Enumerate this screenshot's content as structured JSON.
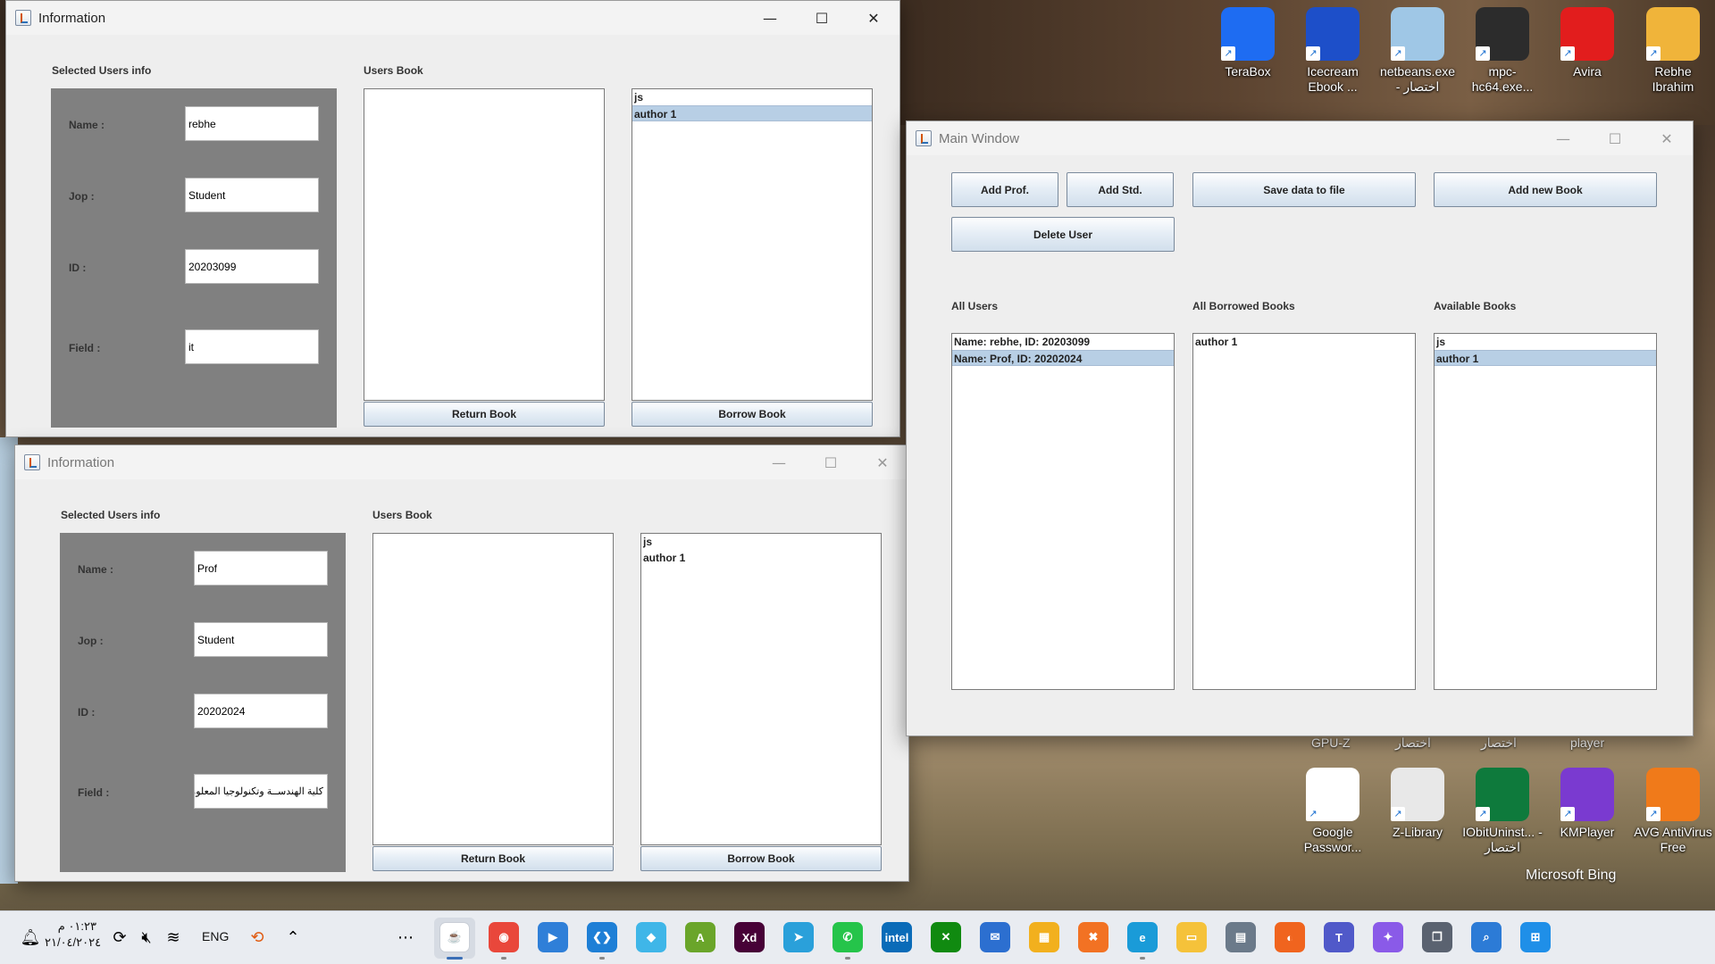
{
  "desktop": {
    "icons": [
      {
        "label": "TeraBox",
        "icon": "terabox-icon",
        "color": "#1e6cf2"
      },
      {
        "label": "Icecream Ebook ...",
        "icon": "icecream-ebook-icon",
        "color": "#1d4fc9"
      },
      {
        "label": "netbeans.exe - اختصار",
        "icon": "netbeans-icon",
        "color": "#9fc7e6"
      },
      {
        "label": "mpc-hc64.exe...",
        "icon": "mpc-hc-icon",
        "color": "#2c2c2c"
      },
      {
        "label": "Avira",
        "icon": "avira-icon",
        "color": "#e21d1d"
      },
      {
        "label": "Rebhe Ibrahim",
        "icon": "user-folder-icon",
        "color": "#f0b43a"
      },
      {
        "label": "Google Passwor...",
        "icon": "google-password-icon",
        "color": "#ffffff"
      },
      {
        "label": "Z-Library",
        "icon": "zlibrary-icon",
        "color": "#e8e8e8"
      },
      {
        "label": "IObitUninst... - اختصار",
        "icon": "iobit-uninstaller-icon",
        "color": "#0e7a3c"
      },
      {
        "label": "KMPlayer",
        "icon": "kmplayer-icon",
        "color": "#7a3ad0"
      },
      {
        "label": "AVG AntiVirus Free",
        "icon": "avg-icon",
        "color": "#f07a1a"
      }
    ],
    "partial_labels": [
      "GPU-Z",
      "اختصار",
      "اختصار",
      "player"
    ],
    "bing_text": "Microsoft Bing"
  },
  "window1": {
    "title": "Information",
    "selected_users_info_label": "Selected Users info",
    "users_book_label": "Users Book",
    "fields": [
      {
        "label": "Name :",
        "value": "rebhe"
      },
      {
        "label": "Jop :",
        "value": "Student"
      },
      {
        "label": "ID :",
        "value": "20203099"
      },
      {
        "label": "Field :",
        "value": "it"
      }
    ],
    "users_book_items": [],
    "available_items": [
      {
        "text": "js",
        "selected": false
      },
      {
        "text": "author 1",
        "selected": true
      }
    ],
    "return_button": "Return Book",
    "borrow_button": "Borrow Book"
  },
  "window2": {
    "title": "Information",
    "selected_users_info_label": "Selected Users info",
    "users_book_label": "Users Book",
    "fields": [
      {
        "label": "Name :",
        "value": "Prof"
      },
      {
        "label": "Jop :",
        "value": "Student"
      },
      {
        "label": "ID :",
        "value": "20202024"
      },
      {
        "label": "Field :",
        "value": "كلية الهندســة وتكنولوجيا المعلومات"
      }
    ],
    "users_book_items": [],
    "available_items": [
      {
        "text": "js",
        "selected": false
      },
      {
        "text": "author 1",
        "selected": false
      }
    ],
    "return_button": "Return Book",
    "borrow_button": "Borrow Book"
  },
  "main_window": {
    "title": "Main Window",
    "buttons": {
      "add_prof": "Add Prof.",
      "add_std": "Add Std.",
      "save_data": "Save data to file",
      "add_new_book": "Add new Book",
      "delete_user": "Delete User"
    },
    "all_users_label": "All Users",
    "all_borrowed_label": "All Borrowed Books",
    "available_books_label": "Available Books",
    "all_users": [
      {
        "text": "Name: rebhe, ID: 20203099",
        "selected": false
      },
      {
        "text": "Name: Prof, ID: 20202024",
        "selected": true
      }
    ],
    "borrowed_books": [
      {
        "text": "author 1",
        "selected": false
      }
    ],
    "available_books": [
      {
        "text": "js",
        "selected": false
      },
      {
        "text": "author 1",
        "selected": true
      }
    ]
  },
  "taskbar": {
    "time": "٠١:٢٣ م",
    "date": "٢١/٠٤/٢٠٢٤",
    "language": "ENG",
    "apps": [
      {
        "name": "java-app-icon",
        "color": "#ffffff",
        "glyph": "☕"
      },
      {
        "name": "chrome-icon",
        "color": "#e9473b",
        "glyph": "◉"
      },
      {
        "name": "media-player-icon",
        "color": "#2f7fd8",
        "glyph": "▶"
      },
      {
        "name": "vscode-icon",
        "color": "#1e7fd6",
        "glyph": "❮❯"
      },
      {
        "name": "store-app-icon",
        "color": "#3fb6e8",
        "glyph": "◆"
      },
      {
        "name": "dictionary-app-icon",
        "color": "#6aa52a",
        "glyph": "A"
      },
      {
        "name": "adobe-xd-icon",
        "color": "#470137",
        "glyph": "Xd"
      },
      {
        "name": "telegram-icon",
        "color": "#2aa0da",
        "glyph": "➤"
      },
      {
        "name": "whatsapp-icon",
        "color": "#25c44a",
        "glyph": "✆"
      },
      {
        "name": "intel-icon",
        "color": "#0a6bb8",
        "glyph": "intel"
      },
      {
        "name": "xbox-icon",
        "color": "#108a10",
        "glyph": "✕"
      },
      {
        "name": "mail-icon",
        "color": "#2c6fd0",
        "glyph": "✉"
      },
      {
        "name": "ms-store-icon",
        "color": "#f2b01e",
        "glyph": "▦"
      },
      {
        "name": "xampp-icon",
        "color": "#f27223",
        "glyph": "✖"
      },
      {
        "name": "edge-icon",
        "color": "#1a9bd8",
        "glyph": "e"
      },
      {
        "name": "file-explorer-icon",
        "color": "#f5c23a",
        "glyph": "▭"
      },
      {
        "name": "calculator-icon",
        "color": "#6b7a8a",
        "glyph": "▤"
      },
      {
        "name": "firefox-icon",
        "color": "#f0641e",
        "glyph": "◐"
      },
      {
        "name": "teams-icon",
        "color": "#5059c9",
        "glyph": "T"
      },
      {
        "name": "copilot-icon",
        "color": "#8a5ae8",
        "glyph": "✦"
      },
      {
        "name": "task-view-icon",
        "color": "#5a6270",
        "glyph": "❐"
      },
      {
        "name": "search-icon",
        "color": "#2c7bd6",
        "glyph": "⌕"
      },
      {
        "name": "start-icon",
        "color": "#1f8fe8",
        "glyph": "⊞"
      }
    ]
  }
}
